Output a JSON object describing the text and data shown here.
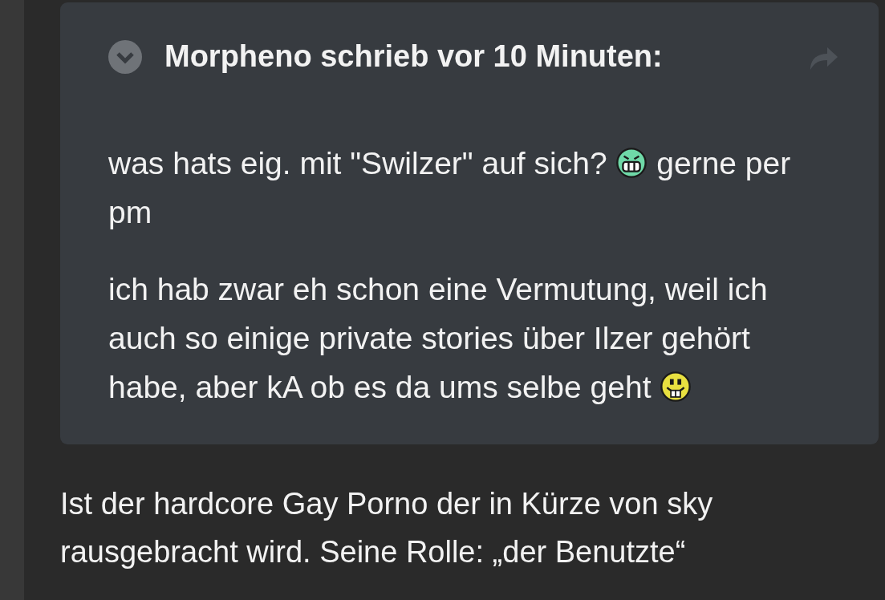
{
  "quote": {
    "author_line": "Morpheno schrieb vor 10 Minuten:",
    "expanded": false,
    "paragraphs": [
      {
        "lines": [
          [
            {
              "kind": "text",
              "text": "was hats eig. mit \"Swilzer\" auf sich?"
            },
            {
              "kind": "grin"
            },
            {
              "kind": "text",
              "text": "gerne per"
            }
          ],
          [
            {
              "kind": "text",
              "text": "pm"
            }
          ]
        ]
      },
      {
        "lines": [
          [
            {
              "kind": "text",
              "text": "ich hab zwar eh schon eine Vermutung, weil ich"
            }
          ],
          [
            {
              "kind": "text",
              "text": "auch so einige private stories über Ilzer gehört"
            }
          ],
          [
            {
              "kind": "text",
              "text": "habe, aber kA ob es da ums selbe geht"
            },
            {
              "kind": "smiley"
            }
          ]
        ]
      }
    ]
  },
  "reply": "Ist der hardcore Gay Porno der in Kürze von sky rausgebracht wird. Seine Rolle: „der Benutzte“"
}
